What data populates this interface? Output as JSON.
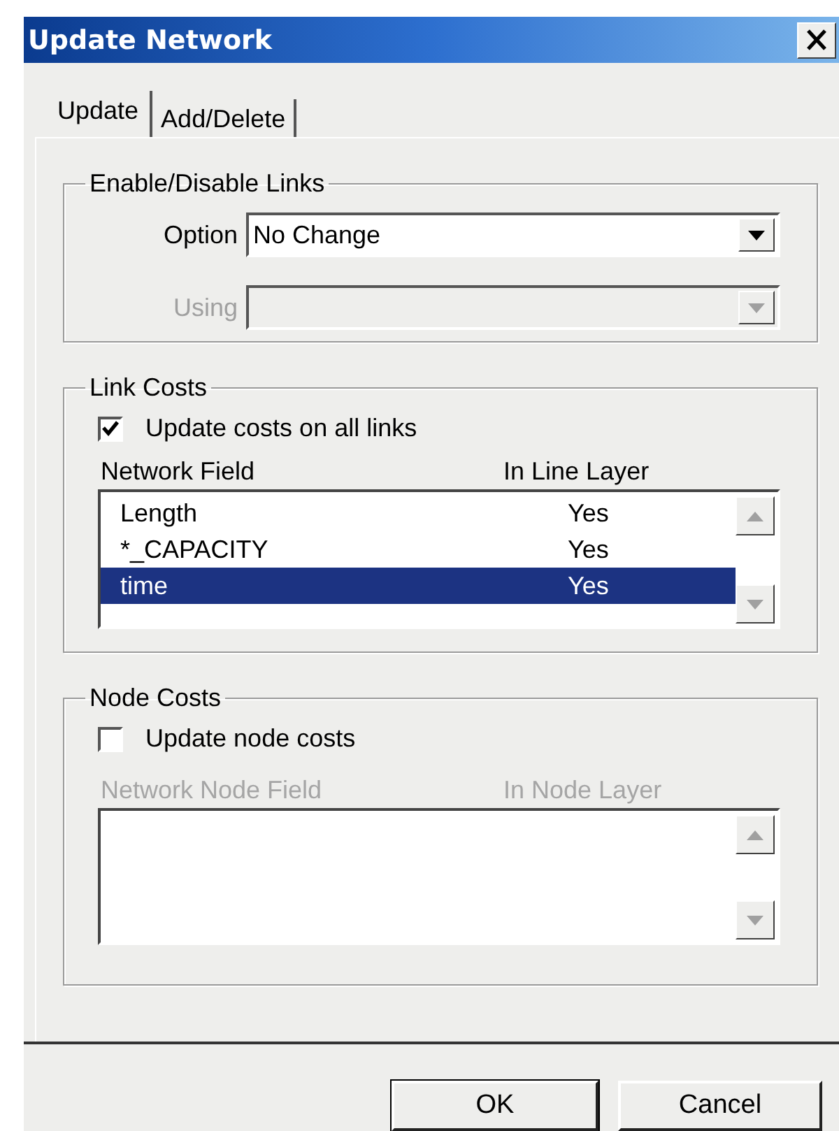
{
  "window": {
    "title": "Update Network"
  },
  "tabs": [
    {
      "label": "Update",
      "selected": true
    },
    {
      "label": "Add/Delete",
      "selected": false
    }
  ],
  "enable_disable_links": {
    "title": "Enable/Disable Links",
    "fields": [
      {
        "label": "Option",
        "value": "No Change",
        "disabled": false
      },
      {
        "label": "Using",
        "disabled": true
      }
    ]
  },
  "link_costs": {
    "title": "Link Costs",
    "checkbox": {
      "label": "Update costs on all links",
      "checked": true
    },
    "disabled": false,
    "columns": [
      "Network Field",
      "In Line Layer"
    ],
    "rows": [
      {
        "field": "Length",
        "in_layer": "Yes",
        "selected": false
      },
      {
        "field": "*_CAPACITY",
        "in_layer": "Yes",
        "selected": false
      },
      {
        "field": "time",
        "in_layer": "Yes",
        "selected": true
      }
    ]
  },
  "node_costs": {
    "title": "Node Costs",
    "checkbox": {
      "label": "Update node costs",
      "checked": false
    },
    "disabled": true,
    "columns": [
      "Network Node Field",
      "In Node Layer"
    ]
  },
  "buttons": [
    "OK",
    "Cancel"
  ]
}
